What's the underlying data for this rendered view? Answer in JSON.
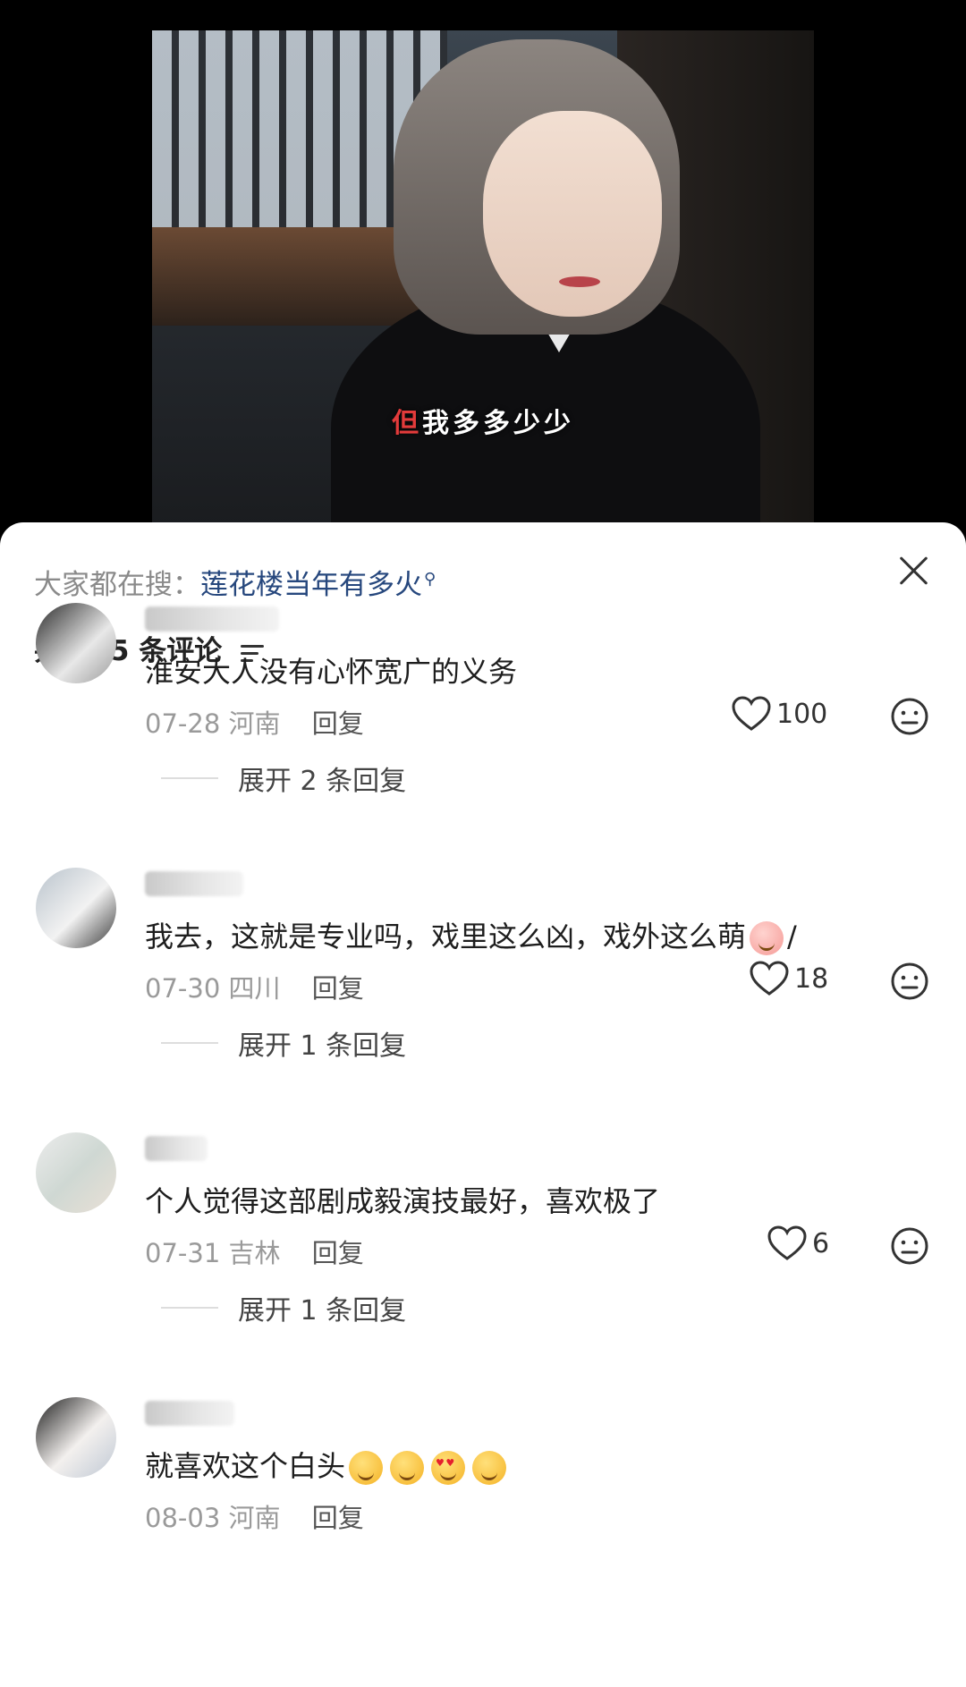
{
  "video": {
    "subtitle_red": "但",
    "subtitle_rest": "我多多少少"
  },
  "sheet": {
    "search_prefix": "大家都在搜：",
    "search_keyword": "莲花楼当年有多火",
    "comment_count_label": "共 125 条评论"
  },
  "comments": [
    {
      "username": "",
      "content": "淮安大人没有心怀宽广的义务",
      "date": "07-28",
      "location": "河南",
      "reply_label": "回复",
      "likes": "100",
      "expand_label": "展开 2 条回复"
    },
    {
      "username": "",
      "content": "我去，这就是专业吗，戏里这么凶，戏外这么萌",
      "content_tail": "/",
      "date": "07-30",
      "location": "四川",
      "reply_label": "回复",
      "likes": "18",
      "expand_label": "展开 1 条回复"
    },
    {
      "username": "",
      "content": "个人觉得这部剧成毅演技最好，喜欢极了",
      "date": "07-31",
      "location": "吉林",
      "reply_label": "回复",
      "likes": "6",
      "expand_label": "展开 1 条回复"
    },
    {
      "username": "",
      "content": "就喜欢这个白头",
      "date": "08-03",
      "location": "河南",
      "reply_label": "回复",
      "likes": "",
      "expand_label": ""
    }
  ],
  "icons": {
    "close": "close-icon",
    "sort": "sort-icon",
    "like": "heart-outline-icon",
    "dislike": "neutral-face-icon",
    "search": "search-icon"
  },
  "colors": {
    "keyword": "#26477d",
    "subtitle_accent": "#e33b3b",
    "meta_gray": "#9a9a9a"
  }
}
